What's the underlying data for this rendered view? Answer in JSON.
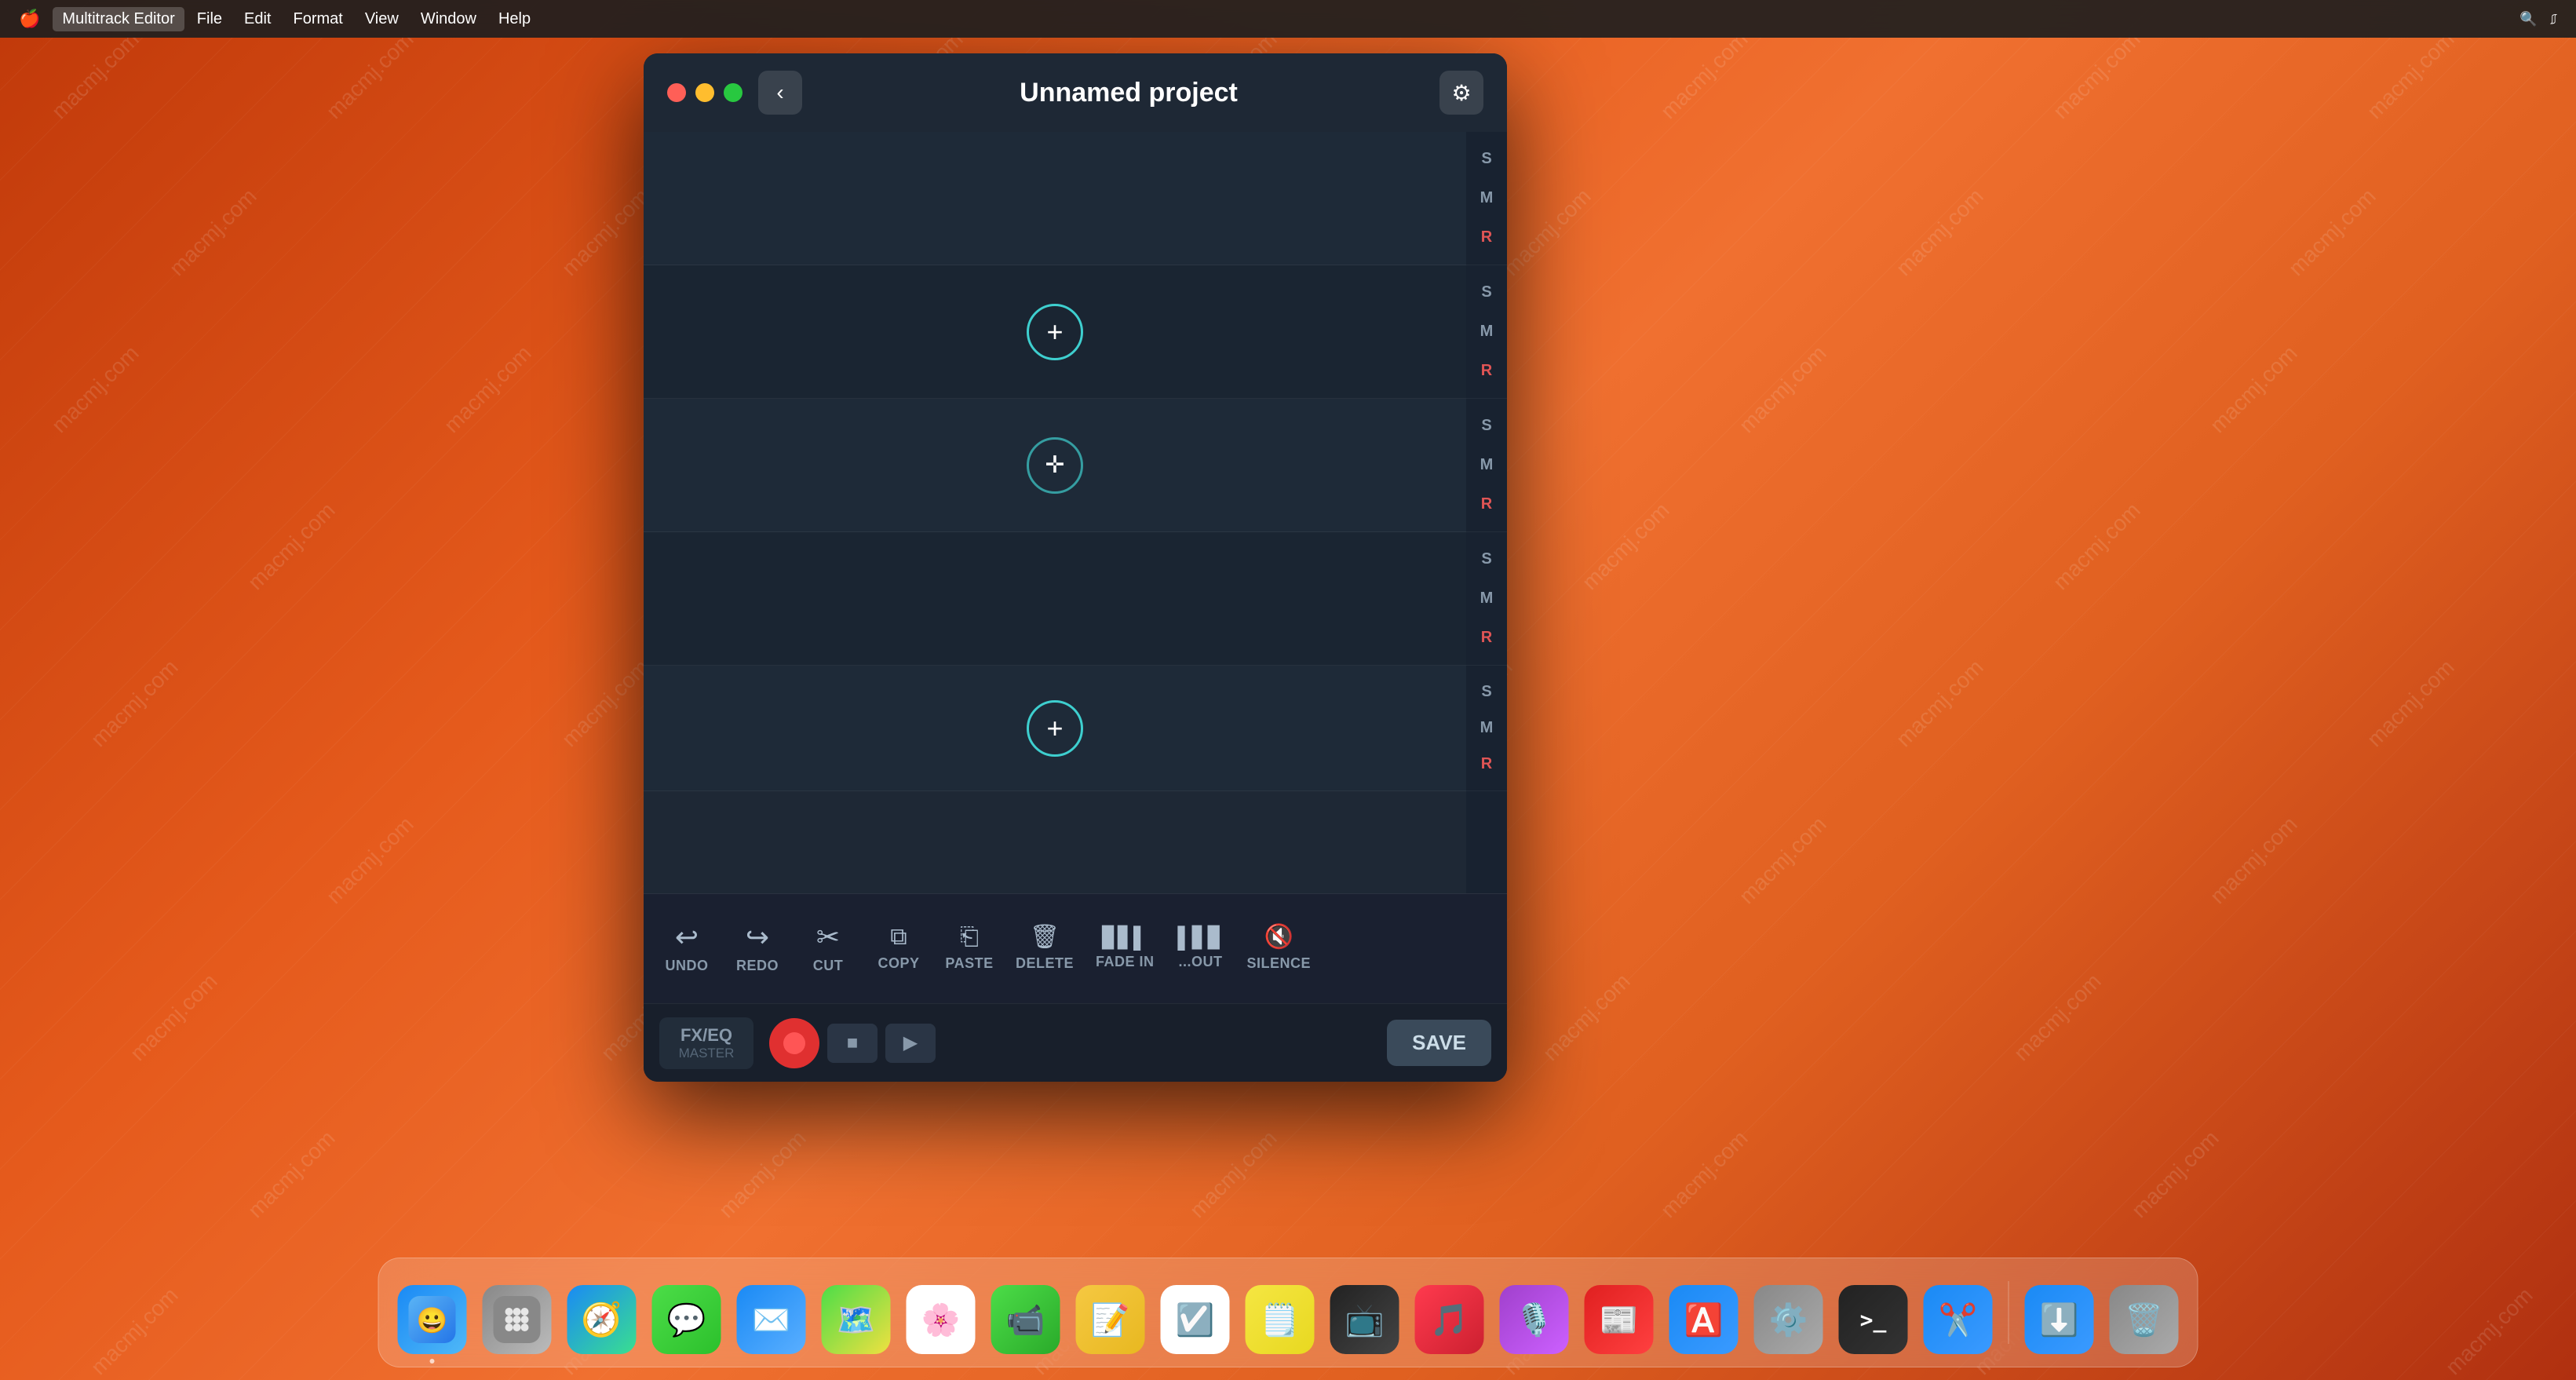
{
  "desktop": {
    "watermark": "macmj.com"
  },
  "menubar": {
    "apple": "🍎",
    "app_name": "Multitrack Editor",
    "items": [
      "File",
      "Edit",
      "Format",
      "View",
      "Window",
      "Help"
    ],
    "active_item": "Edit"
  },
  "window": {
    "title": "Unnamed project",
    "tracks": [
      {
        "id": 1,
        "has_add": false,
        "side": [
          "S",
          "M",
          "R"
        ]
      },
      {
        "id": 2,
        "has_add": true,
        "side": [
          "S",
          "M",
          "R"
        ]
      },
      {
        "id": 3,
        "has_add": true,
        "side": [
          "S",
          "M",
          "R"
        ]
      },
      {
        "id": 4,
        "has_add": false,
        "side": [
          "S",
          "M",
          "R"
        ]
      },
      {
        "id": 5,
        "has_add": true,
        "side": [
          "S",
          "M",
          "R"
        ]
      }
    ]
  },
  "toolbar": {
    "buttons": [
      {
        "id": "undo",
        "label": "UNDO",
        "icon": "↩"
      },
      {
        "id": "redo",
        "label": "REDO",
        "icon": "↪"
      },
      {
        "id": "cut",
        "label": "CUT",
        "icon": "✂"
      },
      {
        "id": "copy",
        "label": "COPY",
        "icon": "⧉"
      },
      {
        "id": "paste",
        "label": "PASTE",
        "icon": "⎗"
      },
      {
        "id": "delete",
        "label": "DELETE",
        "icon": "🗑"
      },
      {
        "id": "fade-in",
        "label": "FADE IN",
        "icon": "▊▋▌▍▎"
      },
      {
        "id": "fade-out",
        "label": "...OUT",
        "icon": "▎▍▌▋▊"
      },
      {
        "id": "silence",
        "label": "SILENCE",
        "icon": "🔇"
      }
    ]
  },
  "transport": {
    "fx_eq": "FX/EQ",
    "master": "MASTER",
    "save": "SAVE"
  },
  "dock": {
    "icons": [
      {
        "id": "finder",
        "emoji": "🔵",
        "label": "Finder",
        "has_dot": true
      },
      {
        "id": "launchpad",
        "emoji": "⠿",
        "label": "Launchpad",
        "has_dot": false
      },
      {
        "id": "safari",
        "emoji": "🧭",
        "label": "Safari",
        "has_dot": false
      },
      {
        "id": "messages",
        "emoji": "💬",
        "label": "Messages",
        "has_dot": false
      },
      {
        "id": "mail",
        "emoji": "✉",
        "label": "Mail",
        "has_dot": false
      },
      {
        "id": "maps",
        "emoji": "🗺",
        "label": "Maps",
        "has_dot": false
      },
      {
        "id": "photos",
        "emoji": "🌸",
        "label": "Photos",
        "has_dot": false
      },
      {
        "id": "facetime",
        "emoji": "📹",
        "label": "FaceTime",
        "has_dot": false
      },
      {
        "id": "notes",
        "emoji": "📝",
        "label": "Notes",
        "has_dot": false
      },
      {
        "id": "reminders",
        "emoji": "☑",
        "label": "Reminders",
        "has_dot": false
      },
      {
        "id": "stickies",
        "emoji": "🗒",
        "label": "Stickies",
        "has_dot": false
      },
      {
        "id": "appletv",
        "emoji": "📺",
        "label": "Apple TV",
        "has_dot": false
      },
      {
        "id": "music",
        "emoji": "♪",
        "label": "Music",
        "has_dot": false
      },
      {
        "id": "podcasts",
        "emoji": "🎙",
        "label": "Podcasts",
        "has_dot": false
      },
      {
        "id": "news",
        "emoji": "📰",
        "label": "News",
        "has_dot": false
      },
      {
        "id": "appstore",
        "emoji": "🅐",
        "label": "App Store",
        "has_dot": false
      },
      {
        "id": "sysprefs",
        "emoji": "⚙",
        "label": "System Preferences",
        "has_dot": false
      },
      {
        "id": "terminal",
        "emoji": ">_",
        "label": "Terminal",
        "has_dot": false
      },
      {
        "id": "scissors",
        "emoji": "✂",
        "label": "Scissors",
        "has_dot": false
      },
      {
        "id": "download",
        "emoji": "⬇",
        "label": "Downloads",
        "has_dot": false
      },
      {
        "id": "trash",
        "emoji": "🗑",
        "label": "Trash",
        "has_dot": false
      }
    ]
  }
}
